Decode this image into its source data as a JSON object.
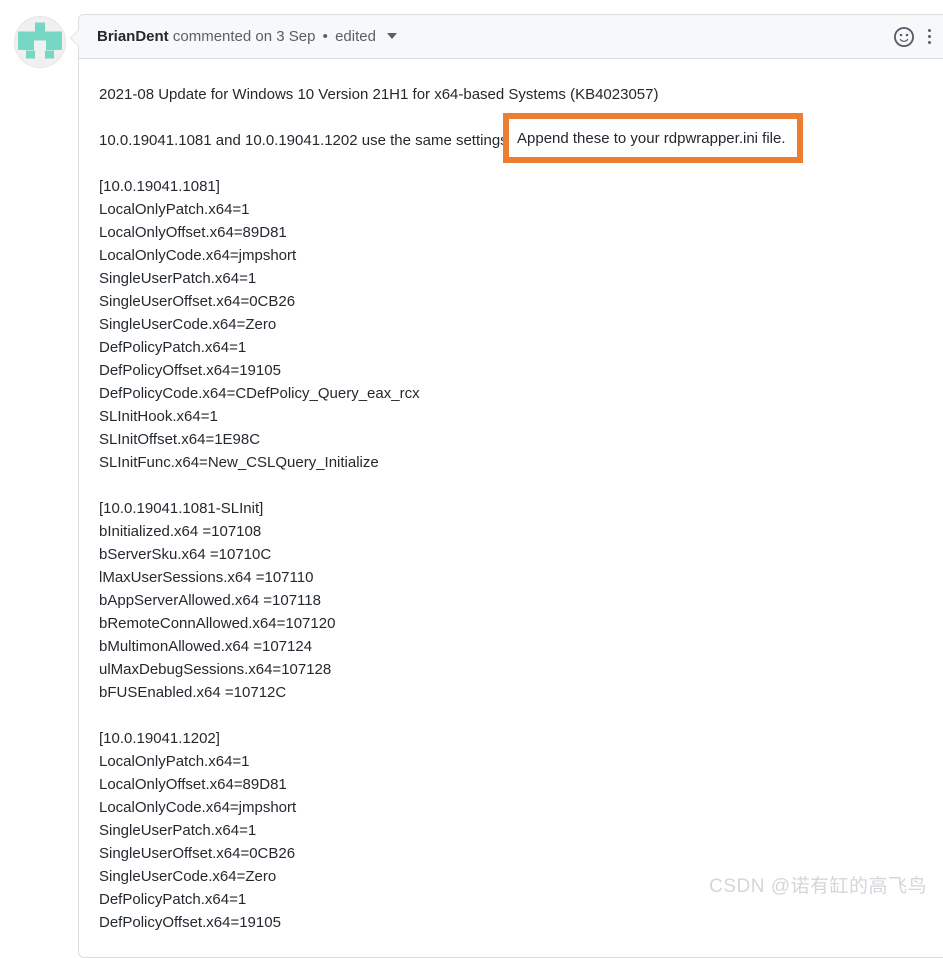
{
  "comment": {
    "author": "BrianDent",
    "action": "commented on",
    "date": "3 Sep",
    "separator": "•",
    "edited_label": "edited",
    "dropdown_icon": "chevron-down-icon",
    "reaction_icon": "smiley-icon",
    "menu_icon": "kebab-menu-icon",
    "avatar_icon": "identicon-avatar",
    "avatar_color": "#76D7C4",
    "avatar_bg": "#f0f0f0"
  },
  "body": {
    "intro": "2021-08 Update for Windows 10 Version 21H1 for x64-based Systems (KB4023057)",
    "note": "10.0.19041.1081 and 10.0.19041.1202 use the same settings",
    "highlight": {
      "text": "Append these to your rdpwrapper.ini file.",
      "border_color": "#ED7D31",
      "background": "#FFFFFF"
    },
    "blocks": [
      {
        "section": "[10.0.19041.1081]",
        "lines": [
          "LocalOnlyPatch.x64=1",
          "LocalOnlyOffset.x64=89D81",
          "LocalOnlyCode.x64=jmpshort",
          "SingleUserPatch.x64=1",
          "SingleUserOffset.x64=0CB26",
          "SingleUserCode.x64=Zero",
          "DefPolicyPatch.x64=1",
          "DefPolicyOffset.x64=19105",
          "DefPolicyCode.x64=CDefPolicy_Query_eax_rcx",
          "SLInitHook.x64=1",
          "SLInitOffset.x64=1E98C",
          "SLInitFunc.x64=New_CSLQuery_Initialize"
        ]
      },
      {
        "section": "[10.0.19041.1081-SLInit]",
        "lines": [
          "bInitialized.x64 =107108",
          "bServerSku.x64 =10710C",
          "lMaxUserSessions.x64 =107110",
          "bAppServerAllowed.x64 =107118",
          "bRemoteConnAllowed.x64=107120",
          "bMultimonAllowed.x64 =107124",
          "ulMaxDebugSessions.x64=107128",
          "bFUSEnabled.x64 =10712C"
        ]
      },
      {
        "section": "[10.0.19041.1202]",
        "lines": [
          "LocalOnlyPatch.x64=1",
          "LocalOnlyOffset.x64=89D81",
          "LocalOnlyCode.x64=jmpshort",
          "SingleUserPatch.x64=1",
          "SingleUserOffset.x64=0CB26",
          "SingleUserCode.x64=Zero",
          "DefPolicyPatch.x64=1",
          "DefPolicyOffset.x64=19105"
        ]
      }
    ]
  },
  "watermark": {
    "text": "CSDN @诺有缸的高飞鸟"
  }
}
